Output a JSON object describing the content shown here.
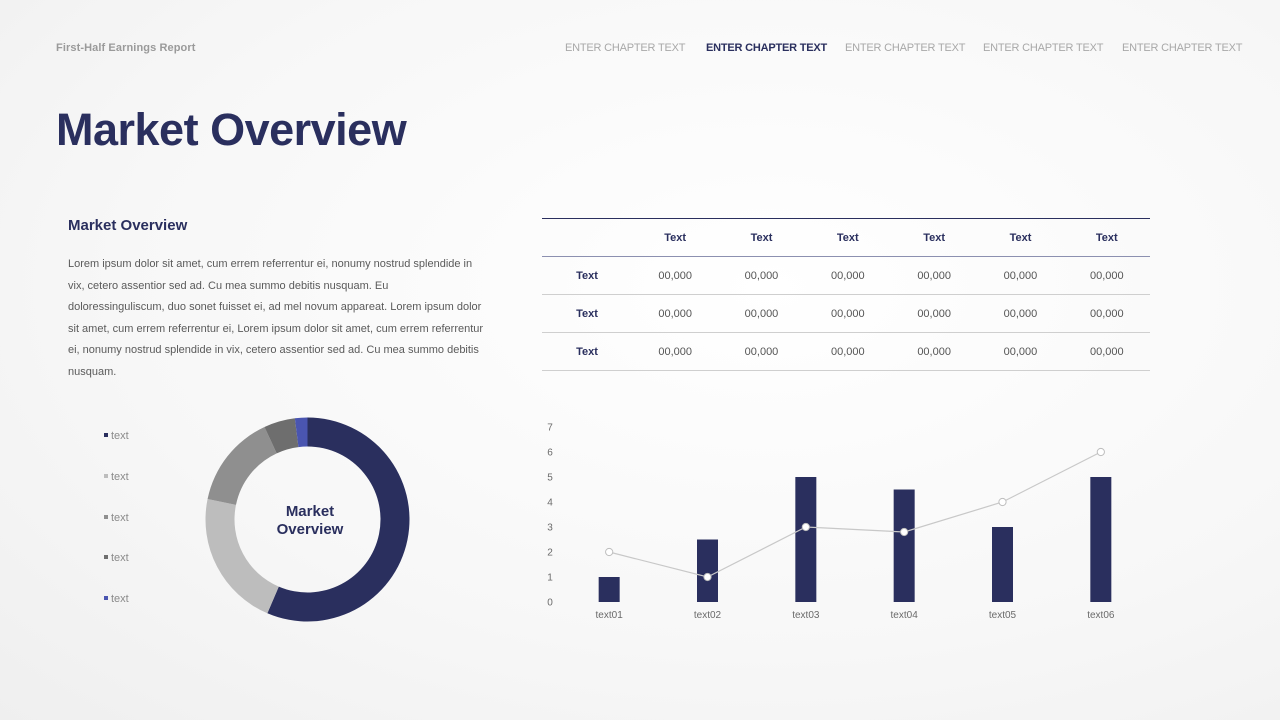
{
  "header": {
    "report_title": "First-Half Earnings Report",
    "chapters": [
      {
        "label": "ENTER CHAPTER TEXT",
        "active": false
      },
      {
        "label": "ENTER CHAPTER TEXT",
        "active": true
      },
      {
        "label": "ENTER CHAPTER TEXT",
        "active": false
      },
      {
        "label": "ENTER CHAPTER TEXT",
        "active": false
      },
      {
        "label": "ENTER CHAPTER TEXT",
        "active": false
      }
    ]
  },
  "main": {
    "title": "Market Overview",
    "section_heading": "Market Overview",
    "body_text": "Lorem ipsum dolor sit amet, cum errem referrentur ei, nonumy nostrud splendide in vix, cetero assentior sed ad. Cu mea summo debitis nusquam. Eu doloressinguliscum, duo sonet fuisset ei, ad mel novum appareat. Lorem ipsum dolor sit amet, cum errem referrentur ei, Lorem ipsum dolor sit amet, cum errem referrentur ei, nonumy nostrud splendide in vix, cetero assentior sed ad. Cu mea summo debitis nusquam."
  },
  "table": {
    "headers": [
      "",
      "Text",
      "Text",
      "Text",
      "Text",
      "Text",
      "Text"
    ],
    "rows": [
      [
        "Text",
        "00,000",
        "00,000",
        "00,000",
        "00,000",
        "00,000",
        "00,000"
      ],
      [
        "Text",
        "00,000",
        "00,000",
        "00,000",
        "00,000",
        "00,000",
        "00,000"
      ],
      [
        "Text",
        "00,000",
        "00,000",
        "00,000",
        "00,000",
        "00,000",
        "00,000"
      ]
    ]
  },
  "colors": {
    "navy": "#2a2f5e",
    "light_gray": "#bdbdbd",
    "mid_gray": "#8f8f8f",
    "dark_gray": "#6e6e6e",
    "blue": "#4a55b0"
  },
  "chart_data": [
    {
      "type": "pie",
      "variant": "donut",
      "center_label": [
        "Market",
        "Overview"
      ],
      "legend_placement": "left",
      "labels": [
        "text",
        "text",
        "text",
        "text",
        "text"
      ],
      "values": [
        57,
        22,
        15,
        5,
        2
      ],
      "colors": [
        "#2a2f5e",
        "#bdbdbd",
        "#8f8f8f",
        "#6e6e6e",
        "#4a55b0"
      ]
    },
    {
      "type": "bar",
      "combo_with": "line",
      "categories": [
        "text01",
        "text02",
        "text03",
        "text04",
        "text05",
        "text06"
      ],
      "series": [
        {
          "type": "bar",
          "values": [
            1,
            2.5,
            5,
            4.5,
            3,
            5
          ],
          "color": "#2a2f5e"
        },
        {
          "type": "line",
          "values": [
            2,
            1,
            3,
            2.8,
            4,
            6
          ],
          "color": "#c8c8c8"
        }
      ],
      "ylim": [
        0,
        7
      ],
      "yticks": [
        0,
        1,
        2,
        3,
        4,
        5,
        6,
        7
      ],
      "grid": false,
      "xlabel": "",
      "ylabel": ""
    }
  ]
}
